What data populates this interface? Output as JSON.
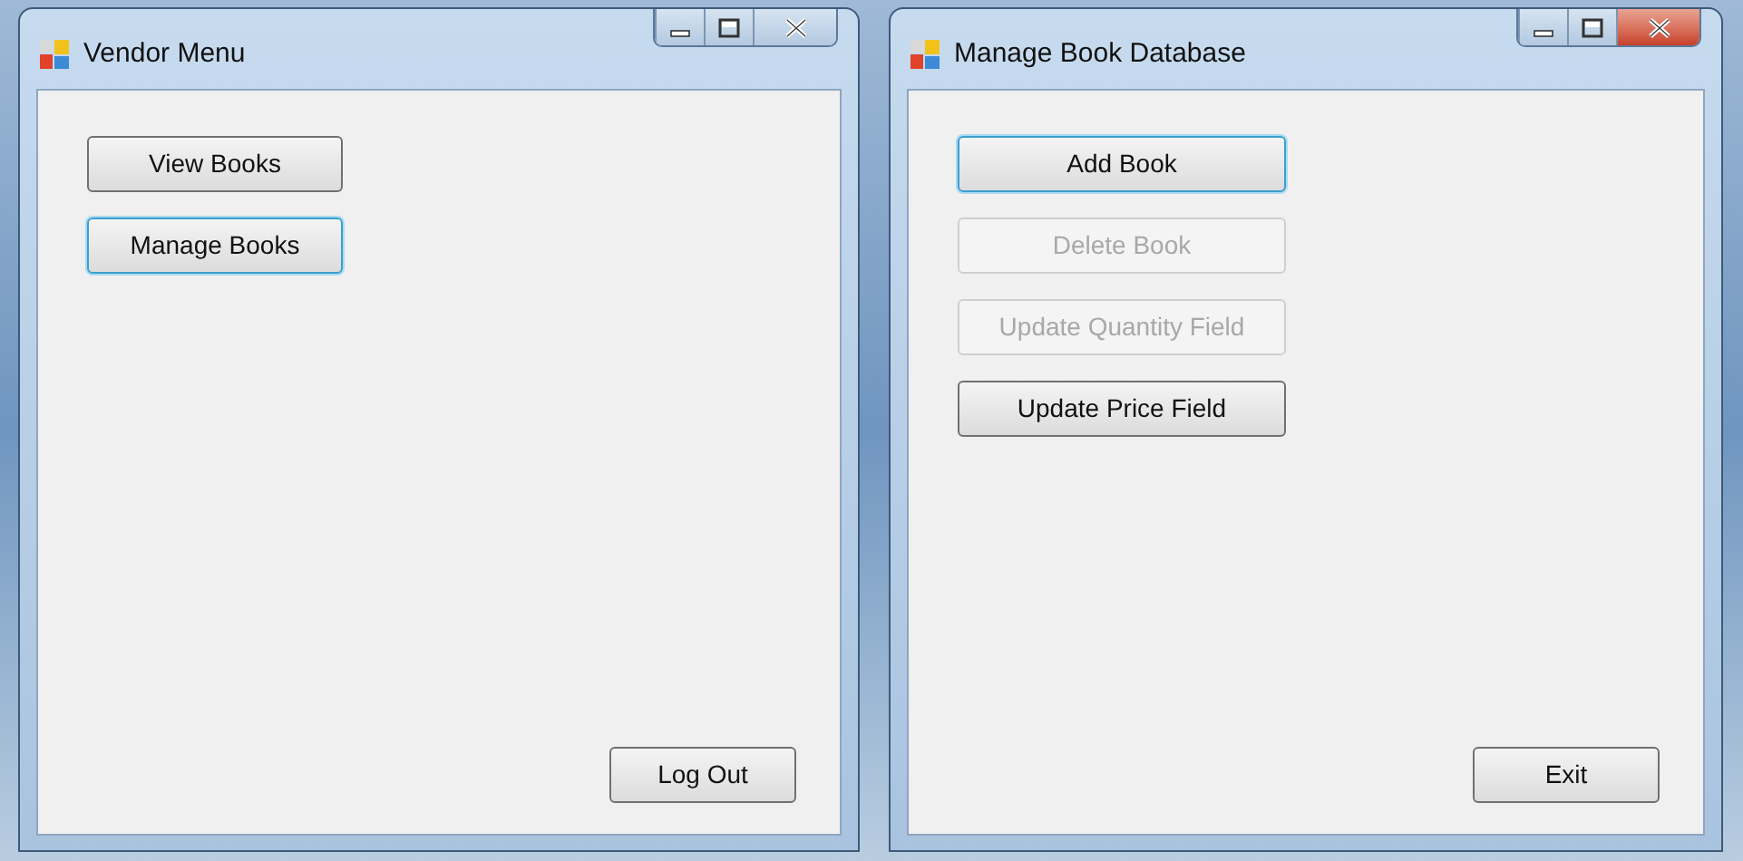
{
  "windows": [
    {
      "title": "Vendor Menu",
      "close_highlighted": false,
      "kind": "menu",
      "buttons": [
        {
          "label": "View Books",
          "disabled": false,
          "focused": false
        },
        {
          "label": "Manage Books",
          "disabled": false,
          "focused": true
        }
      ],
      "footer_button": {
        "label": "Log Out",
        "disabled": false,
        "focused": false
      }
    },
    {
      "title": "Manage Book Database",
      "close_highlighted": true,
      "kind": "manager",
      "buttons": [
        {
          "label": "Add Book",
          "disabled": false,
          "focused": true
        },
        {
          "label": "Delete Book",
          "disabled": true,
          "focused": false
        },
        {
          "label": "Update Quantity Field",
          "disabled": true,
          "focused": false
        },
        {
          "label": "Update Price Field",
          "disabled": false,
          "focused": false
        }
      ],
      "footer_button": {
        "label": "Exit",
        "disabled": false,
        "focused": false
      }
    }
  ]
}
